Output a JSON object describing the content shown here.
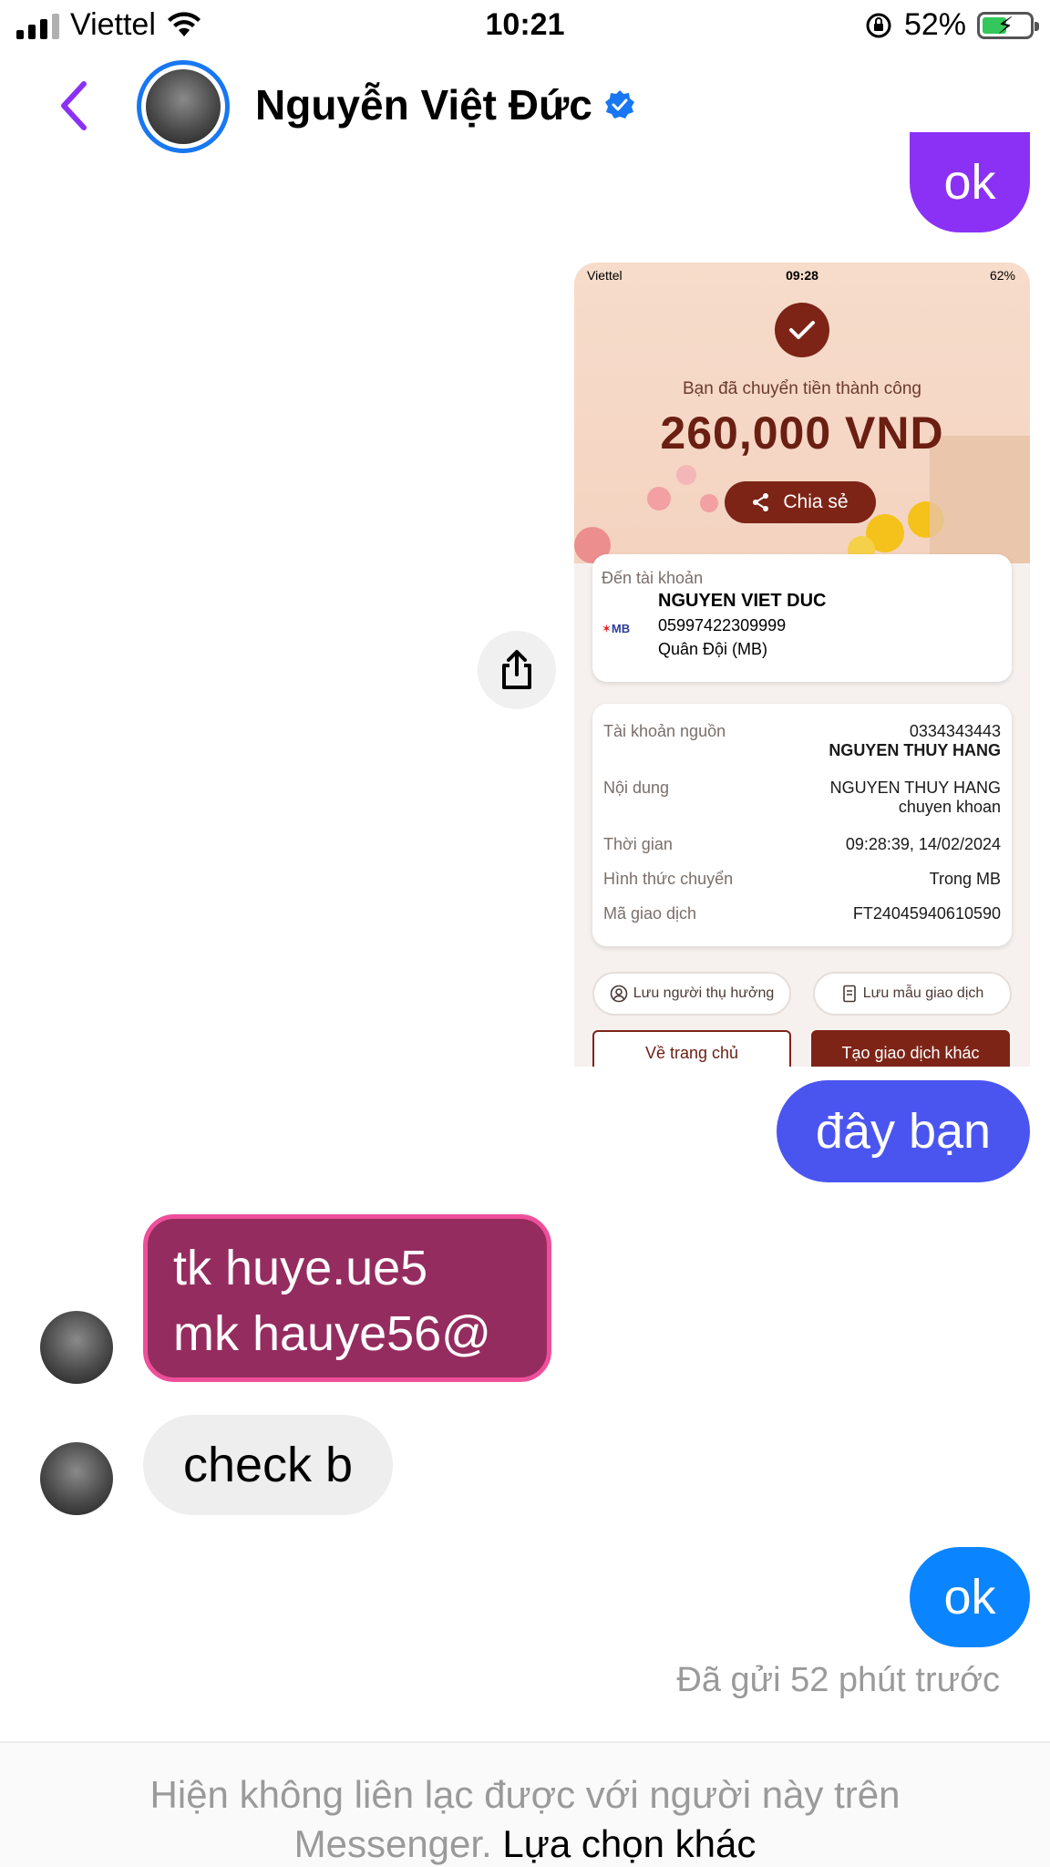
{
  "status_bar": {
    "carrier": "Viettel",
    "time": "10:21",
    "battery_percent": "52%",
    "battery_level": 0.52,
    "icons": [
      "signal-icon",
      "wifi-icon",
      "rotation-lock-icon",
      "battery-charging-icon"
    ]
  },
  "header": {
    "contact_name": "Nguyễn Việt Đức",
    "verified": true
  },
  "messages": {
    "ok_top": "ok",
    "day_ban": "đây bạn",
    "tk_line1": "tk huye.ue5",
    "tk_line2": "mk hauye56@",
    "check_b": "check b",
    "ok_bottom": "ok",
    "sent_status": "Đã gửi 52 phút trước"
  },
  "receipt": {
    "carrier": "Viettel",
    "time": "09:28",
    "battery": "62%",
    "success_text": "Bạn đã chuyển tiền thành công",
    "amount": "260,000 VND",
    "share_label": "Chia sẻ",
    "to_account_label": "Đến tài khoản",
    "recipient_name": "NGUYEN VIET DUC",
    "recipient_account": "05997422309999",
    "recipient_bank": "Quân Đội (MB)",
    "bank_logo": "MB",
    "rows": [
      {
        "label": "Tài khoản nguồn",
        "value": "0334343443",
        "value2": "NGUYEN THUY HANG"
      },
      {
        "label": "Nội dung",
        "value": "NGUYEN THUY HANG",
        "value2": "chuyen khoan"
      },
      {
        "label": "Thời gian",
        "value": "09:28:39, 14/02/2024"
      },
      {
        "label": "Hình thức chuyển",
        "value": "Trong MB"
      },
      {
        "label": "Mã giao dịch",
        "value": "FT24045940610590"
      }
    ],
    "save_beneficiary": "Lưu người thụ hưởng",
    "save_template": "Lưu mẫu giao dịch",
    "home_button": "Về trang chủ",
    "new_transaction_button": "Tạo giao dịch khác"
  },
  "footer": {
    "notice": "Hiện không liên lạc được với người này trên Messenger.",
    "link": "Lựa chọn khác"
  },
  "colors": {
    "purple_bubble": "#8b31f5",
    "indigo_bubble": "#4a55f0",
    "blue_bubble": "#0b84ff",
    "magenta_bubble": "#952c5f",
    "magenta_border": "#ee4f9b",
    "incoming_bubble": "#eeeeee",
    "back_chevron": "#8b31f5",
    "receipt_accent": "#7d2417"
  }
}
